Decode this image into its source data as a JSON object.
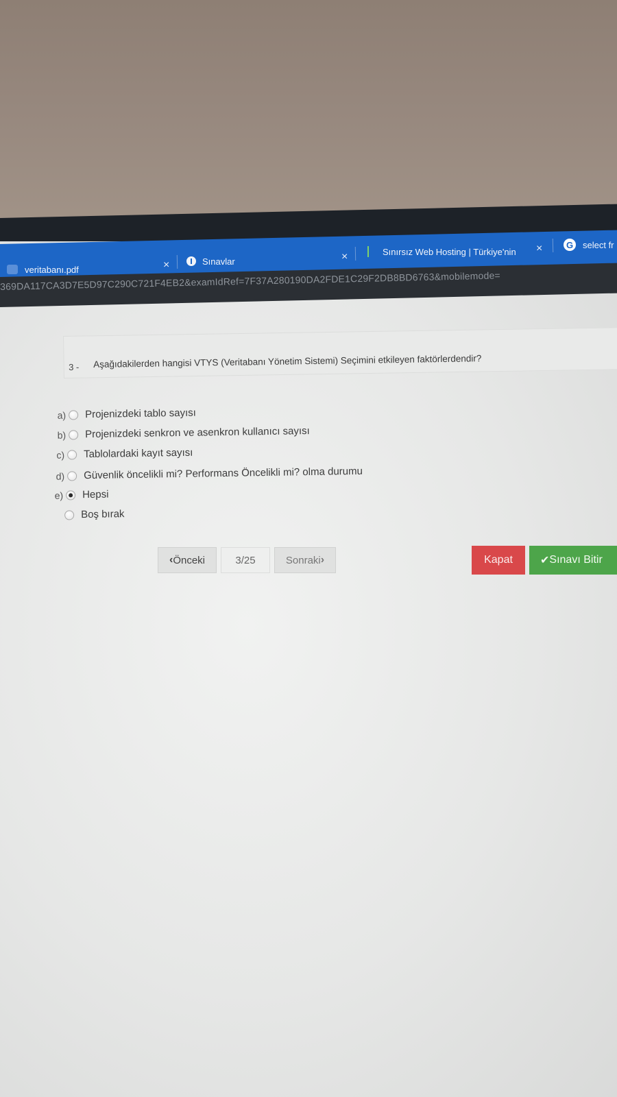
{
  "browser": {
    "tabs": [
      {
        "label": "veritabanı.pdf",
        "icon": "pdf-icon"
      },
      {
        "label": "Sınavlar",
        "icon": "info-icon"
      },
      {
        "label": "Sınırsız Web Hosting | Türkiye'nin",
        "icon": "hosting-icon"
      },
      {
        "label": "select fr",
        "icon": "google-icon"
      }
    ],
    "close_glyph": "×",
    "url": "369DA117CA3D7E5D97C290C721F4EB2&examIdRef=7F37A280190DA2FDE1C29F2DB8BD6763&mobilemode="
  },
  "question": {
    "number": "3 -",
    "text": "Aşağıdakilerden hangisi VTYS (Veritabanı Yönetim Sistemi) Seçimini etkileyen faktörlerdendir?"
  },
  "options": [
    {
      "letter": "a)",
      "text": "Projenizdeki tablo sayısı",
      "checked": false
    },
    {
      "letter": "b)",
      "text": "Projenizdeki senkron ve asenkron kullanıcı sayısı",
      "checked": false
    },
    {
      "letter": "c)",
      "text": "Tablolardaki kayıt sayısı",
      "checked": false
    },
    {
      "letter": "d)",
      "text": "Güvenlik öncelikli mi? Performans Öncelikli mi? olma durumu",
      "checked": false
    },
    {
      "letter": "e)",
      "text": "Hepsi",
      "checked": true
    },
    {
      "letter": "",
      "text": "Boş bırak",
      "checked": false
    }
  ],
  "pager": {
    "prev_label": "Önceki",
    "prev_icon": "chevron-left-icon",
    "counter": "3/25",
    "next_label": "Sonraki",
    "next_icon": "chevron-right-icon"
  },
  "actions": {
    "close_label": "Kapat",
    "finish_label": "Sınavı Bitir",
    "finish_icon": "checkmark-icon",
    "close_color": "#d9484a",
    "finish_color": "#4da54a"
  }
}
